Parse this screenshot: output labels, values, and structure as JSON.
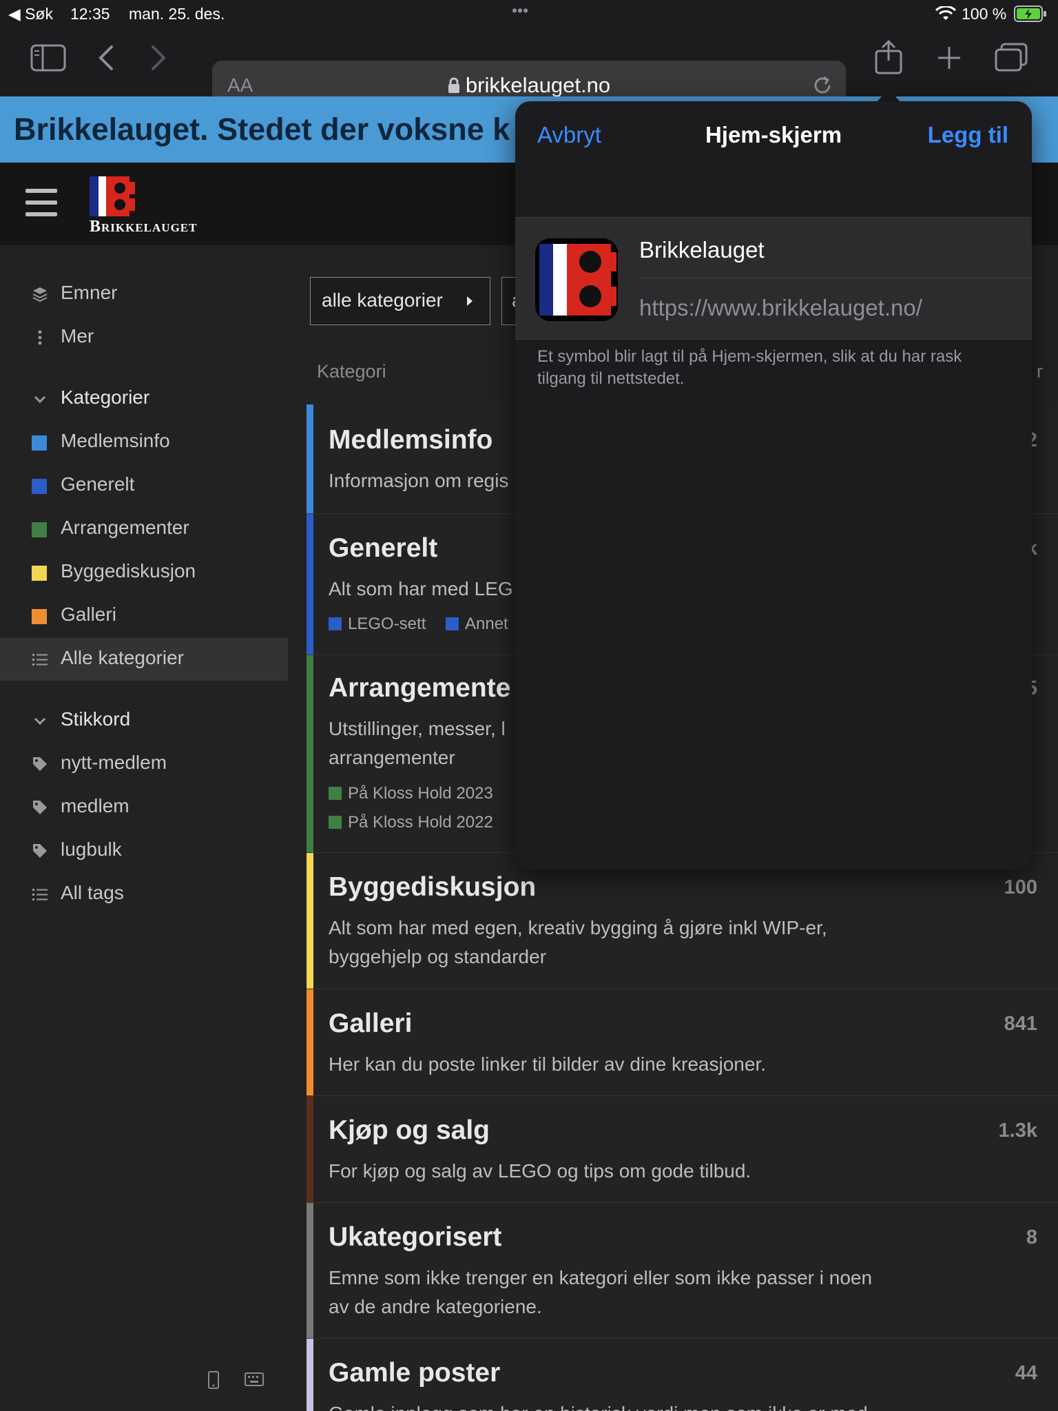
{
  "status": {
    "back": "◀ Søk",
    "time": "12:35",
    "date": "man. 25. des.",
    "dots": "•••",
    "battery": "100 %"
  },
  "toolbar": {
    "aa": "AA",
    "host": "brikkelauget.no"
  },
  "banner": {
    "text": "Brikkelauget. Stedet der voksne k"
  },
  "header": {
    "logo_text": "Brikkelauget"
  },
  "sidebar": {
    "items": [
      {
        "label": "Emner",
        "icon": "layers-icon"
      },
      {
        "label": "Mer",
        "icon": "more-vertical-icon"
      },
      {
        "label": "Kategorier",
        "icon": "chevron-down-icon"
      },
      {
        "label": "Medlemsinfo",
        "color": "#3b8ad8"
      },
      {
        "label": "Generelt",
        "color": "#2a5ec8"
      },
      {
        "label": "Arrangementer",
        "color": "#3f7f44"
      },
      {
        "label": "Byggediskusjon",
        "color": "#f3d651"
      },
      {
        "label": "Galleri",
        "color": "#f08e2f"
      },
      {
        "label": "Alle kategorier",
        "icon": "list-icon"
      },
      {
        "label": "Stikkord",
        "icon": "chevron-down-icon"
      },
      {
        "label": "nytt-medlem",
        "icon": "tag-icon"
      },
      {
        "label": "medlem",
        "icon": "tag-icon"
      },
      {
        "label": "lugbulk",
        "icon": "tag-icon"
      },
      {
        "label": "All tags",
        "icon": "list-icon"
      }
    ]
  },
  "main": {
    "filter1": "alle kategorier",
    "filter2": "a",
    "col_header": "Kategori",
    "col_header_right": "r",
    "categories": [
      {
        "name": "Medlemsinfo",
        "desc": "Informasjon om regis",
        "count": "2",
        "color": "#3b8ad8"
      },
      {
        "name": "Generelt",
        "desc": "Alt som har med LEG",
        "count": "k",
        "color": "#2a5ec8",
        "subs": [
          "LEGO-sett",
          "Annet"
        ]
      },
      {
        "name": "Arrangemente",
        "desc": "Utstillinger, messer, l",
        "desc2": "arrangementer",
        "count": "5",
        "color": "#3f7f44",
        "subs": [
          "På Kloss Hold 2023",
          "På Kloss Hold 2022"
        ]
      },
      {
        "name": "Byggediskusjon",
        "desc": "Alt som har med egen, kreativ bygging å gjøre inkl WIP-er,",
        "desc2": "byggehjelp og standarder",
        "count": "100",
        "color": "#f3d651"
      },
      {
        "name": "Galleri",
        "desc": "Her kan du poste linker til bilder av dine kreasjoner.",
        "count": "841",
        "color": "#f08e2f"
      },
      {
        "name": "Kjøp og salg",
        "desc": "For kjøp og salg av LEGO og tips om gode tilbud.",
        "count": "1.3k",
        "color": "#5a2e1a"
      },
      {
        "name": "Ukategorisert",
        "desc": "Emne som ikke trenger en kategori eller som ikke passer i noen",
        "desc2": "av de andre kategoriene.",
        "count": "8",
        "color": "#7a7a7a"
      },
      {
        "name": "Gamle poster",
        "desc": "Gamle innlegg som har en historisk verdi men som ikke er med",
        "count": "44",
        "color": "#c9c2e6"
      }
    ]
  },
  "popover": {
    "cancel": "Avbryt",
    "title": "Hjem-skjerm",
    "add": "Legg til",
    "app_name": "Brikkelauget",
    "app_url": "https://www.brikkelauget.no/",
    "note": "Et symbol blir lagt til på Hjem-skjermen, slik at du har rask tilgang til nettstedet."
  }
}
